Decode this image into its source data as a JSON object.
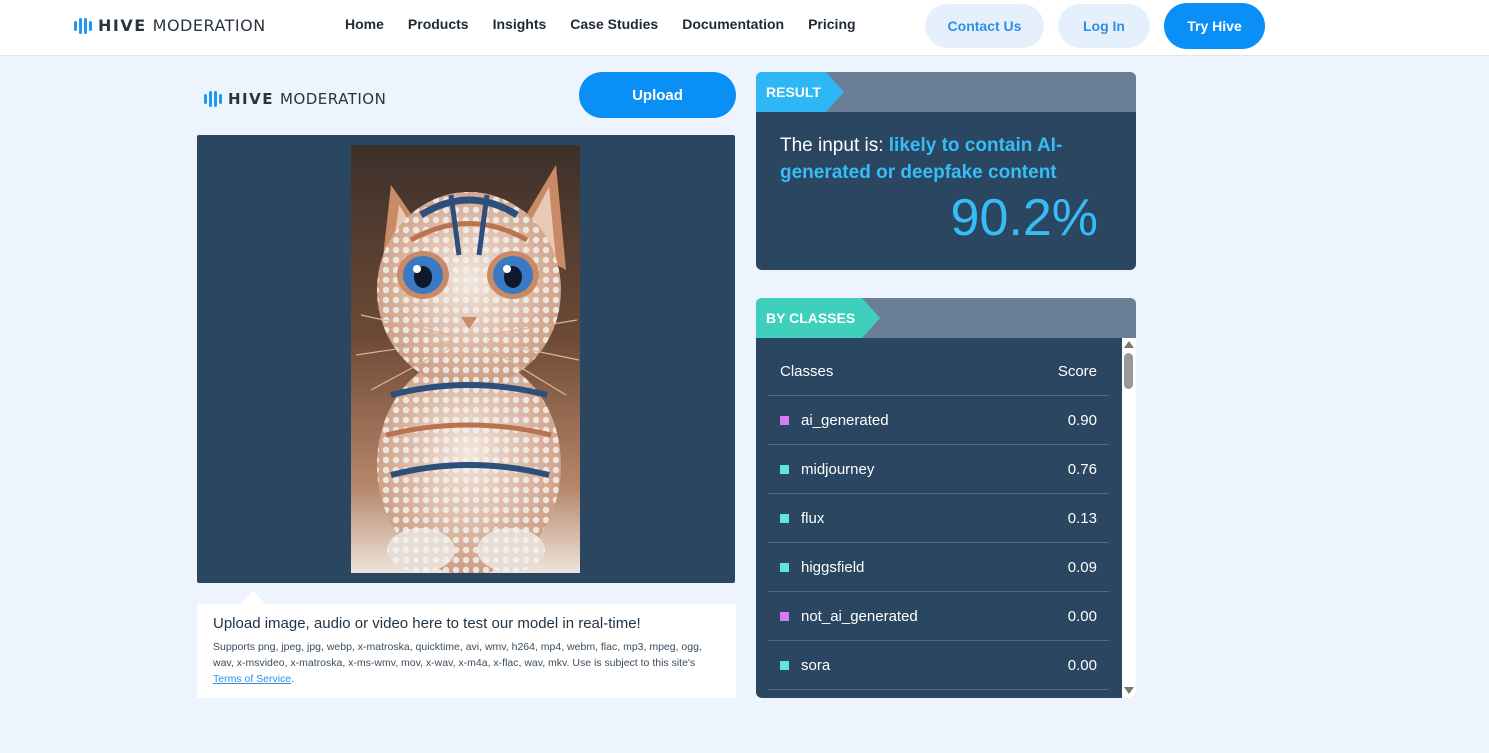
{
  "brand": {
    "word1": "HIVE",
    "word2": "MODERATION",
    "color": "#2196f3"
  },
  "nav": {
    "items": [
      "Home",
      "Products",
      "Insights",
      "Case Studies",
      "Documentation",
      "Pricing"
    ],
    "contact_label": "Contact Us",
    "login_label": "Log In",
    "try_label": "Try Hive"
  },
  "upload": {
    "button_label": "Upload",
    "title": "Upload image, audio or video here to test our model in real-time!",
    "supports": "Supports png, jpeg, jpg, webp, x-matroska, quicktime, avi, wmv, h264, mp4, webm, flac, mp3, mpeg, ogg, wav, x-msvideo, x-matroska, x-ms-wmv, mov, x-wav, x-m4a, x-flac, wav, mkv. Use is subject to this site's ",
    "terms_link": "Terms of Service",
    "terms_end": "."
  },
  "result": {
    "tag": "RESULT",
    "prefix": "The input is: ",
    "verdict": "likely to contain AI-generated or deepfake content",
    "percent": "90.2%"
  },
  "classes": {
    "tag": "BY CLASSES",
    "header_class": "Classes",
    "header_score": "Score",
    "rows": [
      {
        "name": "ai_generated",
        "score": "0.90",
        "color": "#d77cf0"
      },
      {
        "name": "midjourney",
        "score": "0.76",
        "color": "#5fe6d6"
      },
      {
        "name": "flux",
        "score": "0.13",
        "color": "#5fe6d6"
      },
      {
        "name": "higgsfield",
        "score": "0.09",
        "color": "#5fe6d6"
      },
      {
        "name": "not_ai_generated",
        "score": "0.00",
        "color": "#d77cf0"
      },
      {
        "name": "sora",
        "score": "0.00",
        "color": "#5fe6d6"
      }
    ]
  },
  "colors": {
    "accent": "#0a8ff7",
    "panel": "#2a4660",
    "highlight": "#36bdf5"
  }
}
